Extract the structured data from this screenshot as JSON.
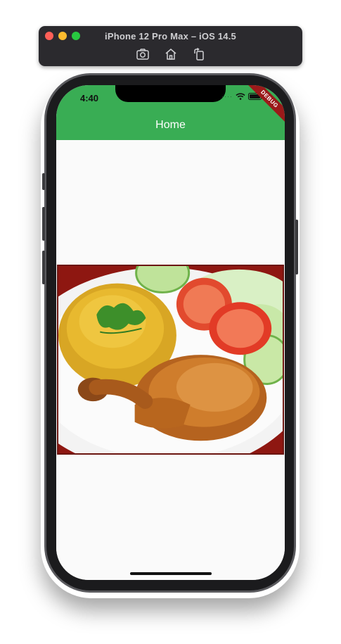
{
  "simulator": {
    "title": "iPhone 12 Pro Max – iOS 14.5",
    "toolbar_icons": [
      "screenshot-icon",
      "home-icon",
      "rotate-icon"
    ],
    "colors": {
      "close": "#fe5f57",
      "minimize": "#febc2e",
      "maximize": "#28c840"
    }
  },
  "status_bar": {
    "time": "4:40"
  },
  "app_bar": {
    "title": "Home",
    "color": "#39ad54"
  },
  "debug_banner": {
    "label": "DEBUG"
  },
  "content": {
    "image": {
      "description_icon": "food-photo",
      "alt": ""
    }
  }
}
